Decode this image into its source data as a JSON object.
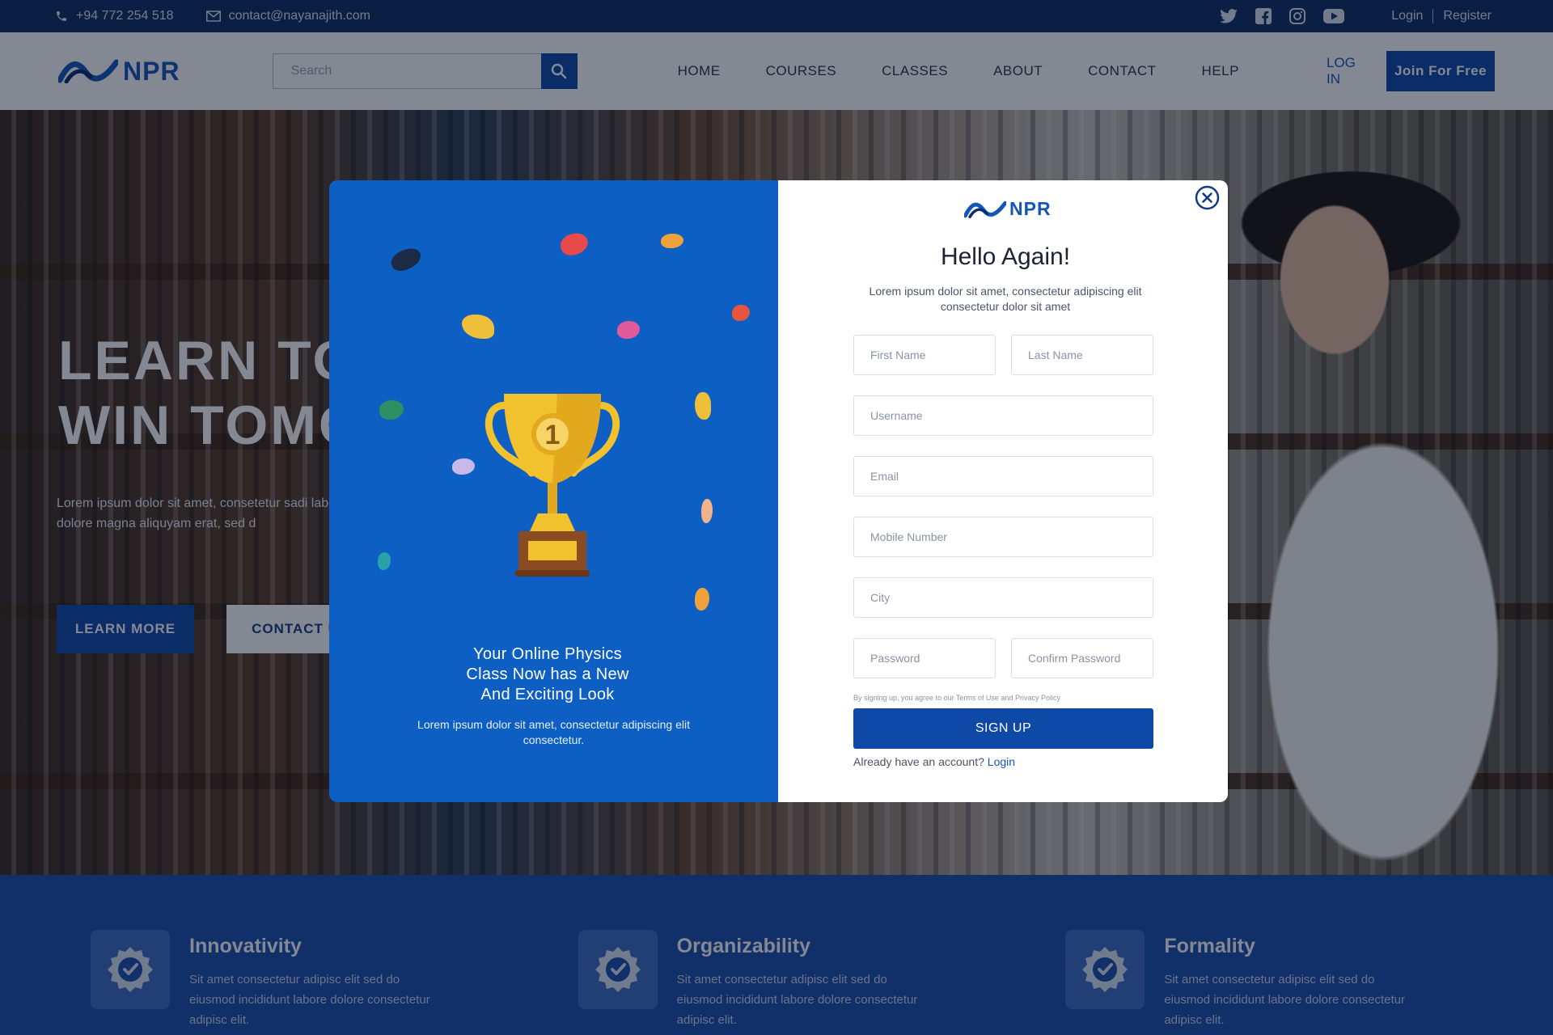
{
  "topbar": {
    "phone": "+94 772 254 518",
    "email": "contact@nayanajith.com",
    "socials": [
      "twitter-icon",
      "facebook-icon",
      "instagram-icon",
      "youtube-icon"
    ],
    "login": "Login",
    "register": "Register"
  },
  "header": {
    "logo": "NPR",
    "search_placeholder": "Search",
    "nav": [
      "HOME",
      "COURSES",
      "CLASSES",
      "ABOUT",
      "CONTACT",
      "HELP"
    ],
    "login": "LOG IN",
    "join": "Join For Free"
  },
  "hero": {
    "title_line1": "LEARN TO",
    "title_line2": "WIN TOMO",
    "subtitle": "Lorem ipsum dolor sit amet, consetetur sadi labore et dolore magna aliquyam erat, sed d",
    "learn_more": "LEARN MORE",
    "contact": "CONTACT U"
  },
  "features": [
    {
      "title": "Innovativity",
      "text": "Sit amet consectetur adipisc elit sed do eiusmod  incididunt labore dolore consectetur adipisc elit."
    },
    {
      "title": "Organizability",
      "text": "Sit amet consectetur adipisc elit sed do eiusmod  incididunt labore dolore consectetur adipisc elit."
    },
    {
      "title": "Formality",
      "text": "Sit amet consectetur adipisc elit sed do eiusmod  incididunt labore dolore consectetur adipisc elit."
    }
  ],
  "modal": {
    "left": {
      "heading": "Your Online Physics Class Now has a New And Exciting Look",
      "description": "Lorem ipsum dolor sit amet, consectetur adipiscing elit consectetur."
    },
    "right": {
      "logo": "NPR",
      "title": "Hello Again!",
      "lead": "Lorem ipsum dolor sit amet, consectetur adipiscing elit consectetur dolor sit amet",
      "placeholders": {
        "first_name": "First Name",
        "last_name": "Last Name",
        "username": "Username",
        "email": "Email",
        "mobile": "Mobile Number",
        "city": "City",
        "password": "Password",
        "confirm_password": "Confirm Password"
      },
      "terms": "By signing up, you agree to our Terms of Use and Privacy Policy",
      "signup": "SIGN UP",
      "have_account": "Already have an account?",
      "login_link": "Login"
    }
  },
  "colors": {
    "brand": "#0f49a7",
    "modal_blue": "#0d5fc4",
    "topbar": "#0f2a5e",
    "trophy": "#f2c12e"
  }
}
